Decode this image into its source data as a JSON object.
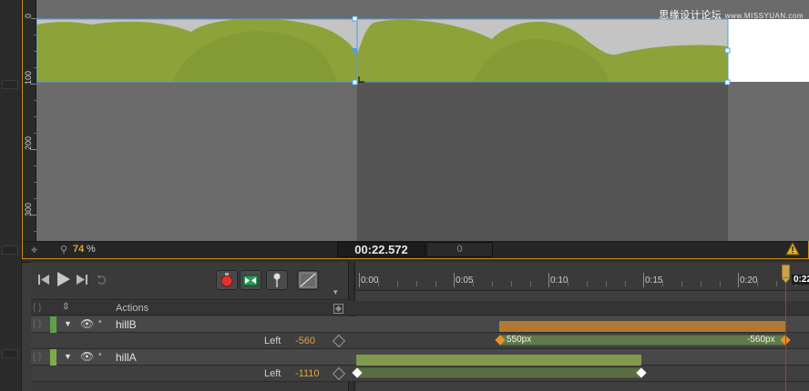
{
  "watermark": {
    "text": "思缘设计论坛",
    "site": "www.MISSYUAN.com"
  },
  "stage": {
    "ruler_labels": [
      "0",
      "100",
      "200",
      "300"
    ],
    "zoom_value": "74",
    "zoom_unit": "%",
    "current_time": "00:22.572",
    "frame_value": "0"
  },
  "colors": {
    "accent": "#d08a1a",
    "hill_green": "#8ea23a",
    "hill_dark": "#7a922e",
    "playhead": "#c8302a",
    "bar_orange": "#b07a32",
    "bar_green": "#7f9a4e",
    "layer_hillB": "#5ca04a",
    "layer_hillA": "#7faa4a",
    "warning": "#e8b020"
  },
  "timeline": {
    "time_labels": [
      "0:00",
      "0:05",
      "0:10",
      "0:15",
      "0:20",
      "0:22"
    ],
    "actions_label": "Actions",
    "layers": [
      {
        "name": "hillB",
        "property": "Left",
        "value": "-560",
        "bar_start_label": "550px",
        "bar_end_label": "-560px"
      },
      {
        "name": "hillA",
        "property": "Left",
        "value": "-1110"
      }
    ],
    "icons": [
      "previous-icon",
      "play-icon",
      "next-icon",
      "loop-icon",
      "record-icon",
      "transition-icon",
      "pin-icon",
      "easing-icon"
    ]
  }
}
